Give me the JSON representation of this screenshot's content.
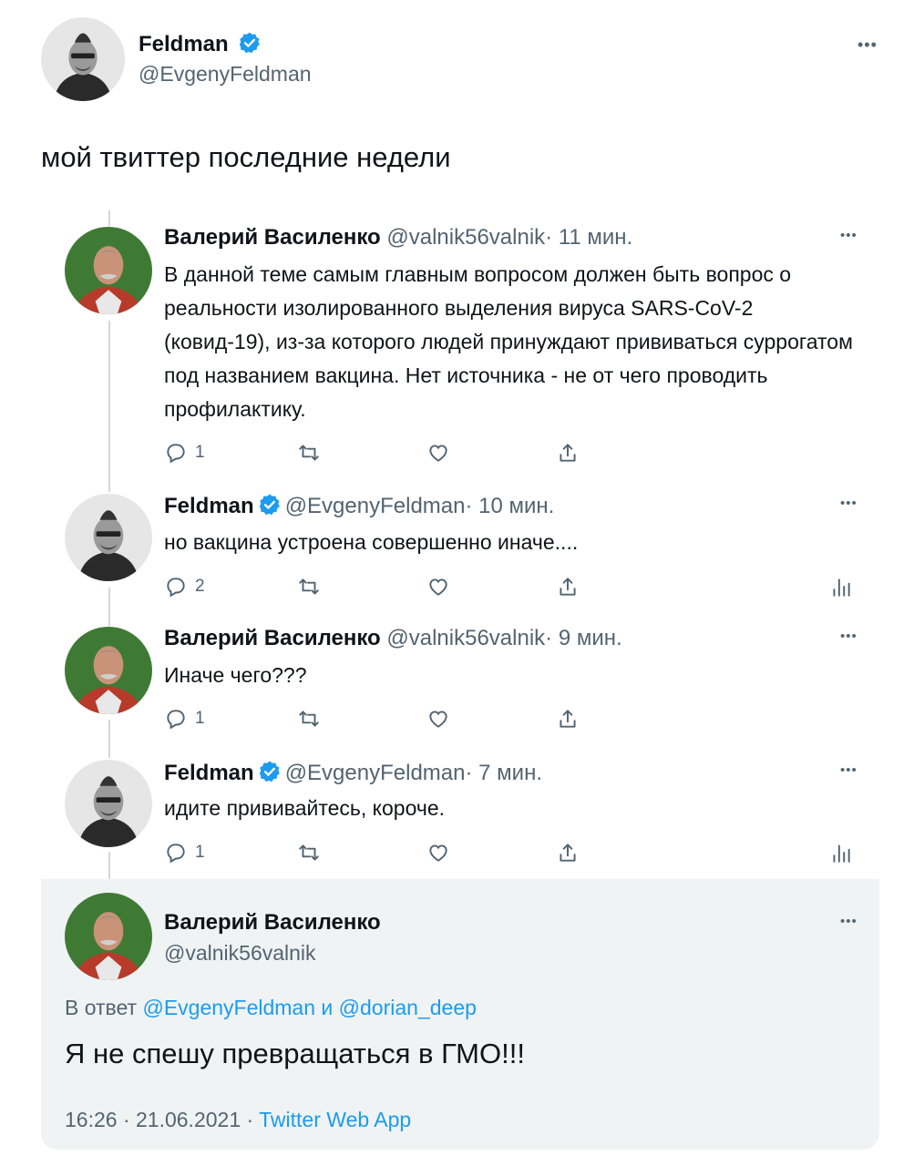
{
  "main_tweet": {
    "display_name": "Feldman",
    "handle": "@EvgenyFeldman",
    "text": "мой твиттер последние недели"
  },
  "quoted_thread": [
    {
      "display_name": "Валерий Василенко",
      "handle": "@valnik56valnik",
      "time": "· 11 мин.",
      "verified": false,
      "text": "В данной теме самым главным вопросом должен быть вопрос о реальности изолированного выделения вируса SARS-CoV-2 (ковид-19), из-за которого людей принуждают прививаться суррогатом под названием вакцина. Нет источника - не от чего проводить профилактику.",
      "reply_count": "1"
    },
    {
      "display_name": "Feldman",
      "handle": "@EvgenyFeldman",
      "time": "· 10 мин.",
      "verified": true,
      "text": "но вакцина устроена совершенно иначе....",
      "reply_count": "2"
    },
    {
      "display_name": "Валерий Василенко",
      "handle": "@valnik56valnik",
      "time": "· 9 мин.",
      "verified": false,
      "text": "Иначе чего???",
      "reply_count": "1"
    },
    {
      "display_name": "Feldman",
      "handle": "@EvgenyFeldman",
      "time": "· 7 мин.",
      "verified": true,
      "text": "идите прививайтесь, короче.",
      "reply_count": "1"
    }
  ],
  "focused_tweet": {
    "display_name": "Валерий Василенко",
    "handle": "@valnik56valnik",
    "reply_prefix": "В ответ",
    "reply_to_1": "@EvgenyFeldman",
    "reply_and": "и",
    "reply_to_2": "@dorian_deep",
    "text": "Я не спешу превращаться в ГМО!!!",
    "timestamp": "16:26 · 21.06.2021 ·",
    "source": "Twitter Web App"
  },
  "icons": {
    "more": "more-dots-icon",
    "verified": "verified-badge-icon",
    "reply": "reply-icon",
    "retweet": "retweet-icon",
    "like": "like-icon",
    "share": "share-icon",
    "analytics": "analytics-icon"
  },
  "colors": {
    "accent": "#1d9bf0",
    "secondary_text": "#536471",
    "focused_bg": "#eff3f4"
  }
}
